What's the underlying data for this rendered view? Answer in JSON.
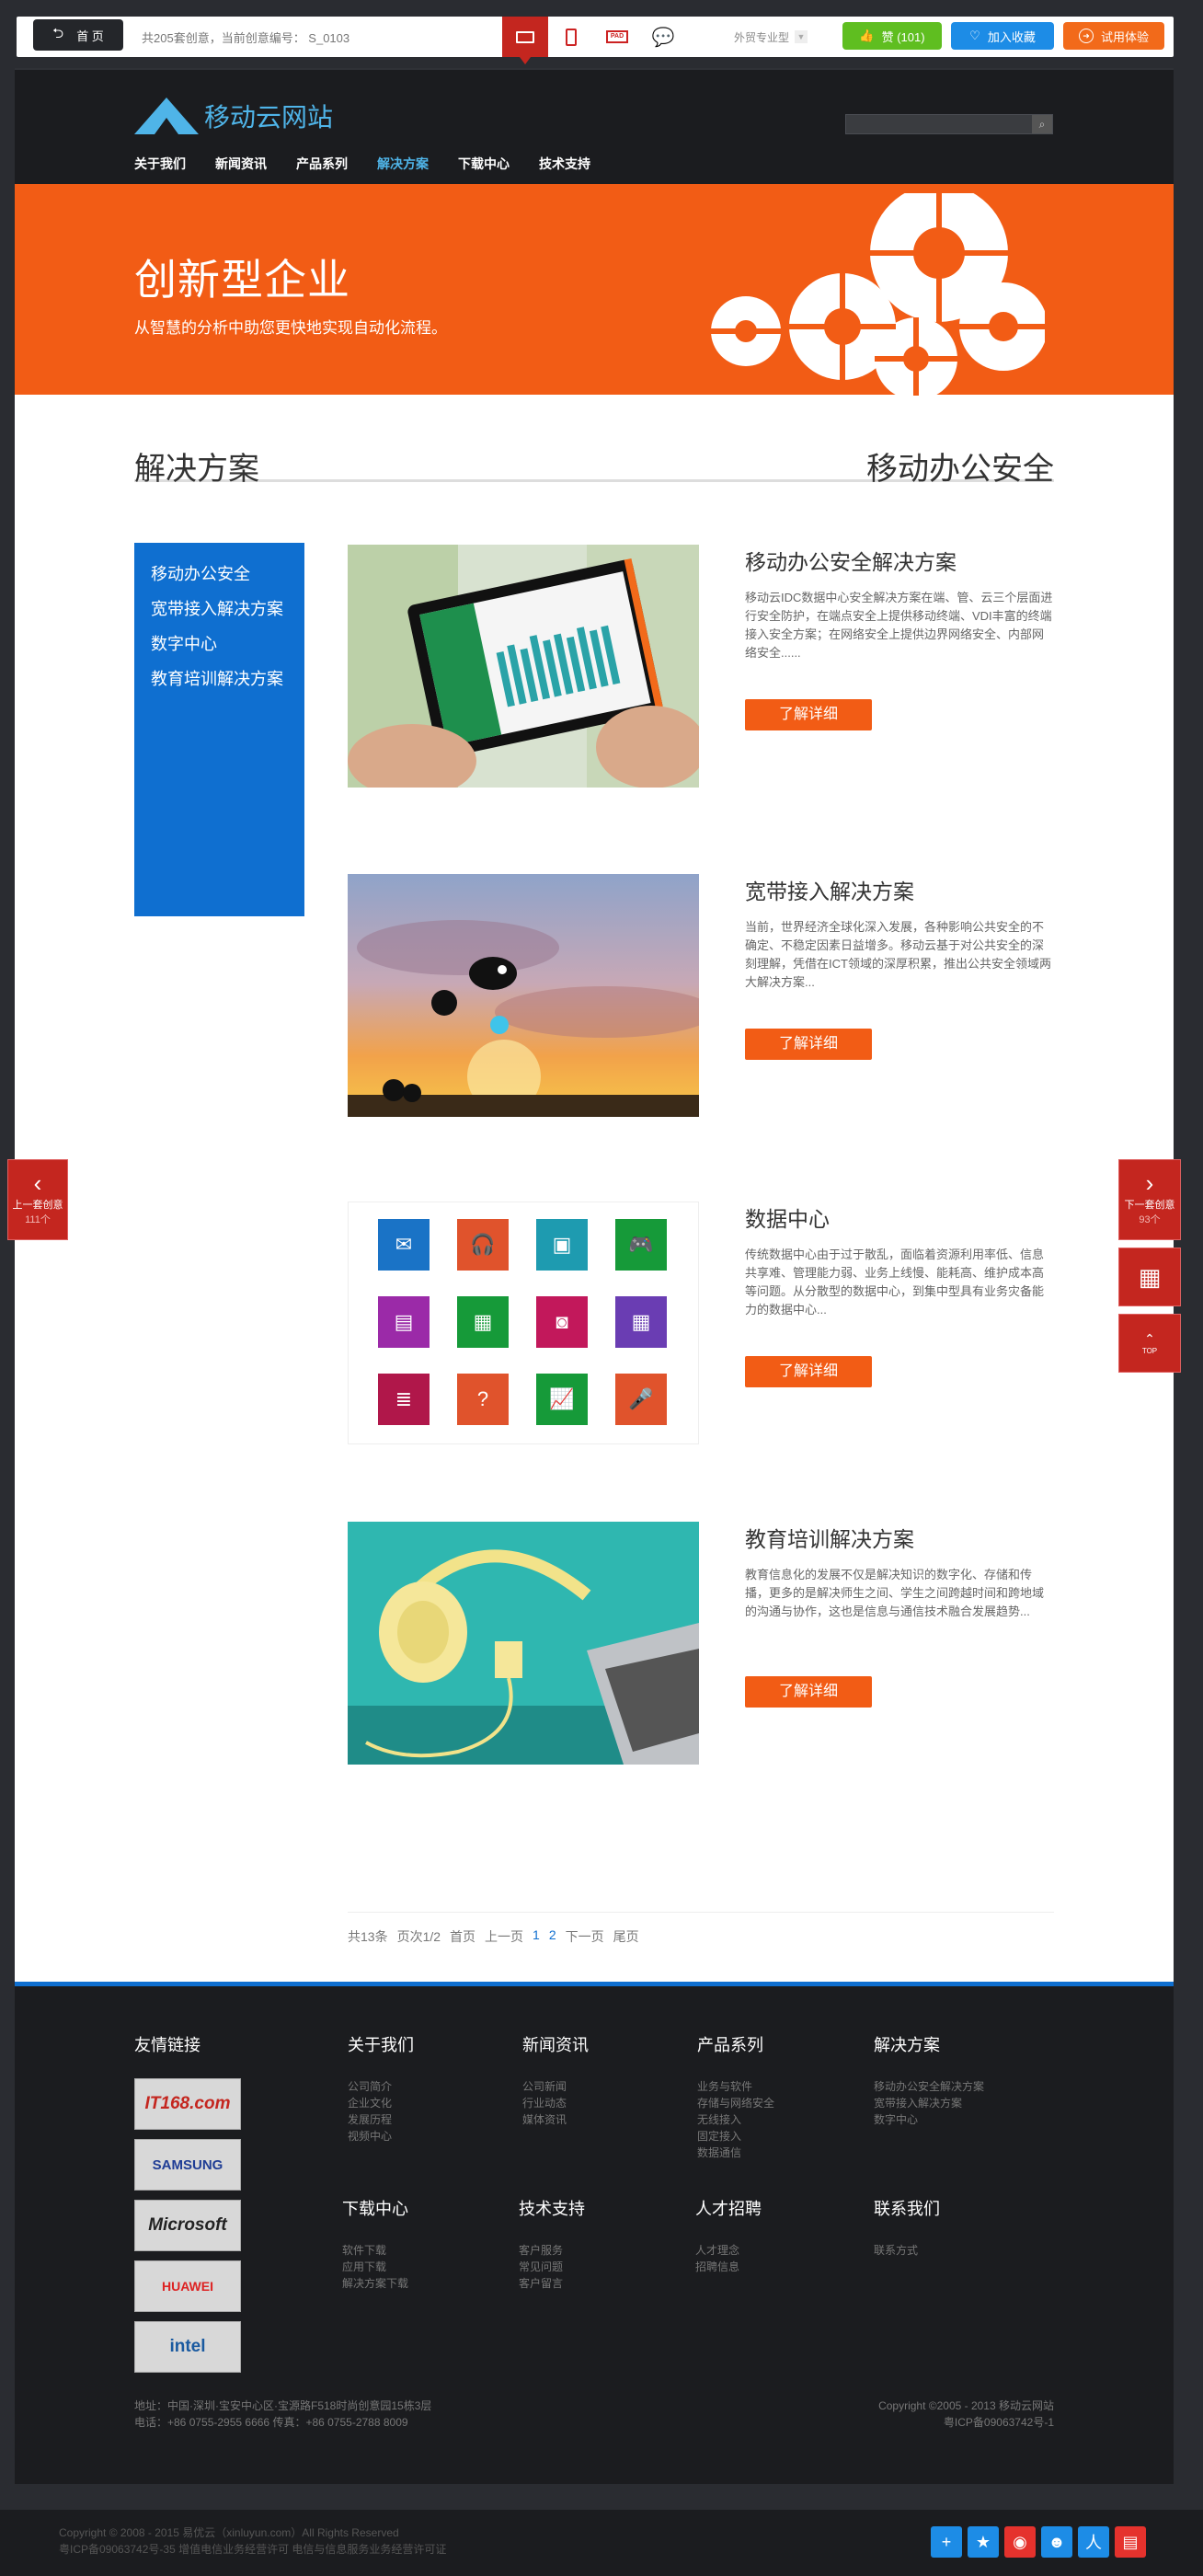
{
  "toolbar": {
    "home_label": "首 页",
    "count_text": "共205套创意，当前创意编号： S_0103",
    "industry_label": "外贸专业型",
    "like_label": "赞 (101)",
    "fav_label": "加入收藏",
    "try_label": "试用体验"
  },
  "site": {
    "logo_text": "移动云网站",
    "nav": [
      "关于我们",
      "新闻资讯",
      "产品系列",
      "解决方案",
      "下载中心",
      "技术支持"
    ],
    "banner_title": "创新型企业",
    "banner_sub": "从智慧的分析中助您更快地实现自动化流程。",
    "section_left": "解决方案",
    "section_right": "移动办公安全",
    "side_menu": [
      "移动办公安全",
      "宽带接入解决方案",
      "数字中心",
      "教育培训解决方案"
    ],
    "more_label": "了解详细",
    "items": [
      {
        "title": "移动办公安全解决方案",
        "desc": "移动云IDC数据中心安全解决方案在端、管、云三个层面进行安全防护，在端点安全上提供移动终端、VDI丰富的终端接入安全方案；在网络安全上提供边界网络安全、内部网络安全......"
      },
      {
        "title": "宽带接入解决方案",
        "desc": "当前，世界经济全球化深入发展，各种影响公共安全的不确定、不稳定因素日益增多。移动云基于对公共安全的深刻理解，凭借在ICT领域的深厚积累，推出公共安全领域两大解决方案..."
      },
      {
        "title": "数据中心",
        "desc": "传统数据中心由于过于散乱，面临着资源利用率低、信息共享难、管理能力弱、业务上线慢、能耗高、维护成本高等问题。从分散型的数据中心，到集中型具有业务灾备能力的数据中心..."
      },
      {
        "title": "教育培训解决方案",
        "desc": "教育信息化的发展不仅是解决知识的数字化、存储和传播，更多的是解决师生之间、学生之间跨越时间和跨地域的沟通与协作，这也是信息与通信技术融合发展趋势..."
      }
    ],
    "pager": {
      "total": "共13条",
      "page": "页次1/2",
      "first": "首页",
      "prev": "上一页",
      "current": "1",
      "next_num": "2",
      "next": "下一页",
      "last": "尾页"
    }
  },
  "footer": {
    "partners_title": "友情链接",
    "partners": [
      "IT168.com",
      "SAMSUNG",
      "Microsoft",
      "HUAWEI",
      "intel"
    ],
    "cols": [
      {
        "title": "关于我们",
        "links": [
          "公司简介",
          "企业文化",
          "发展历程",
          "视频中心"
        ]
      },
      {
        "title": "新闻资讯",
        "links": [
          "公司新闻",
          "行业动态",
          "媒体资讯"
        ]
      },
      {
        "title": "产品系列",
        "links": [
          "业务与软件",
          "存储与网络安全",
          "无线接入",
          "固定接入",
          "数据通信"
        ]
      },
      {
        "title": "解决方案",
        "links": [
          "移动办公安全解决方案",
          "宽带接入解决方案",
          "数字中心"
        ]
      },
      {
        "title": "下载中心",
        "links": [
          "软件下载",
          "应用下载",
          "解决方案下载"
        ]
      },
      {
        "title": "技术支持",
        "links": [
          "客户服务",
          "常见问题",
          "客户留言"
        ]
      },
      {
        "title": "人才招聘",
        "links": [
          "人才理念",
          "招聘信息"
        ]
      },
      {
        "title": "联系我们",
        "links": [
          "联系方式"
        ]
      }
    ],
    "address": "地址：中国·深圳·宝安中心区·宝源路F518时尚创意园15栋3层",
    "phone": "电话：+86 0755-2955 6666    传真：+86 0755-2788 8009",
    "copyright": "Copyright ©2005 - 2013 移动云网站",
    "icp": "粤ICP备09063742号-1"
  },
  "page_foot": {
    "line1": "Copyright © 2008 - 2015 易优云（xinluyun.com）All Rights Reserved",
    "line2": "粤ICP备09063742号-35 增值电信业务经营许可 电信与信息服务业务经营许可证"
  },
  "side": {
    "prev_label": "上一套创意",
    "prev_count": "111个",
    "next_label": "下一套创意",
    "next_count": "93个",
    "top_label": "TOP"
  }
}
